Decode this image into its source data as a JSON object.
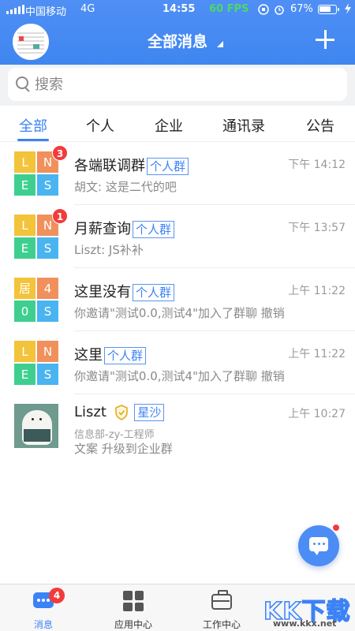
{
  "status_bar": {
    "carrier": "中国移动",
    "network": "4G",
    "time": "14:55",
    "fps": "60 FPS",
    "battery": "67%"
  },
  "header": {
    "title": "全部消息"
  },
  "search": {
    "placeholder": "搜索"
  },
  "tabs": [
    {
      "label": "全部",
      "active": true
    },
    {
      "label": "个人"
    },
    {
      "label": "企业"
    },
    {
      "label": "通讯录"
    },
    {
      "label": "公告"
    }
  ],
  "conversations": [
    {
      "avatar_cells": [
        "L",
        "N",
        "E",
        "S"
      ],
      "unread": "3",
      "name": "各端联调群",
      "tag": "个人群",
      "time": "下午 14:12",
      "preview": "胡文: 这是二代的吧"
    },
    {
      "avatar_cells": [
        "L",
        "N",
        "E",
        "S"
      ],
      "unread": "1",
      "name": "月薪查询",
      "tag": "个人群",
      "time": "下午 13:57",
      "preview": "Liszt: JS补补"
    },
    {
      "avatar_cells": [
        "居",
        "4",
        "0",
        "S"
      ],
      "name": "这里没有",
      "tag": "个人群",
      "time": "上午 11:22",
      "preview": "你邀请\"测试0.0,测试4\"加入了群聊 撤销"
    },
    {
      "avatar_cells": [
        "L",
        "N",
        "E",
        "S"
      ],
      "name": "这里",
      "tag": "个人群",
      "time": "上午 11:22",
      "preview": "你邀请\"测试0.0,测试4\"加入了群聊 撤销"
    },
    {
      "avatar": "bear-photo",
      "name": "Liszt",
      "tag": "星沙",
      "department": "信息部-zy-工程师",
      "time": "上午 10:27",
      "preview": "文案  升级到企业群"
    }
  ],
  "bottom_nav": [
    {
      "label": "消息",
      "badge": "4",
      "icon": "message-icon",
      "active": true
    },
    {
      "label": "应用中心",
      "icon": "apps-grid-icon"
    },
    {
      "label": "工作中心",
      "icon": "briefcase-icon"
    }
  ],
  "watermark": {
    "text": "KK下载",
    "url": "www.kkx.net"
  },
  "colors": {
    "accent": "#3b82f6",
    "badge": "#f23b3b",
    "header": "#4a8cf4"
  }
}
